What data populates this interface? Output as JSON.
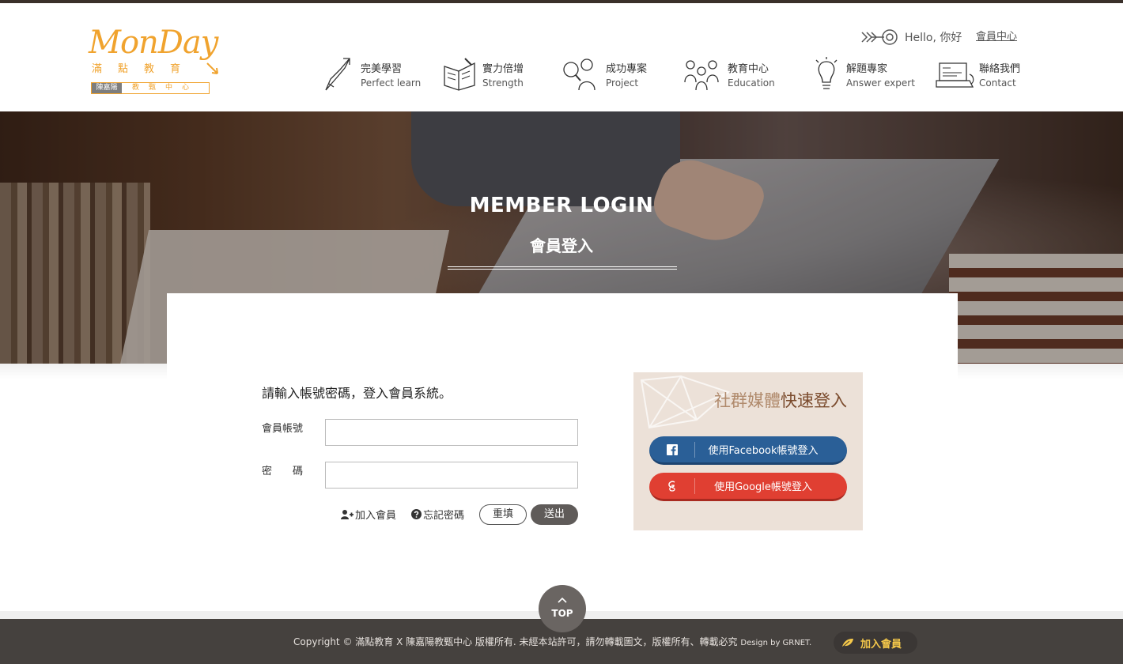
{
  "header": {
    "logo": {
      "brand": "MonDay",
      "brand_zh": "滿點教育",
      "sub_left": "陳嘉陽",
      "sub_right": "教甄中心"
    },
    "hello": "Hello, 你好",
    "member_center": "會員中心",
    "nav": [
      {
        "zh": "完美學習",
        "en": "Perfect learn",
        "icon": "rocket-arrow-icon"
      },
      {
        "zh": "實力倍增",
        "en": "Strength",
        "icon": "open-book-icon"
      },
      {
        "zh": "成功專案",
        "en": "Project",
        "icon": "magnifier-person-icon"
      },
      {
        "zh": "教育中心",
        "en": "Education",
        "icon": "people-group-icon"
      },
      {
        "zh": "解題專家",
        "en": "Answer expert",
        "icon": "lightbulb-icon"
      },
      {
        "zh": "聯絡我們",
        "en": "Contact",
        "icon": "laptop-icon"
      }
    ]
  },
  "hero": {
    "title": "MEMBER LOGIN",
    "subtitle": "會員登入"
  },
  "login": {
    "intro": "請輸入帳號密碼，登入會員系統。",
    "username_label": "會員帳號",
    "password_label": "密碼",
    "username_value": "",
    "password_value": "",
    "join_link": "加入會員",
    "forgot_link": "忘記密碼",
    "reset_button": "重填",
    "submit_button": "送出"
  },
  "social": {
    "title_light": "社群媒體",
    "title_accent": "快速登入",
    "facebook_button": "使用Facebook帳號登入",
    "google_button": "使用Google帳號登入"
  },
  "footer": {
    "copyright": "Copyright © 滿點教育 X 陳嘉陽教甄中心 版權所有. 未經本站許可，請勿轉載圖文，版權所有、轉載必究",
    "design": "Design by GRNET.",
    "join_button": "加入會員",
    "top_button": "TOP"
  },
  "colors": {
    "brand_orange": "#f0a32e",
    "footer_bg": "#45413e",
    "facebook_blue": "#2a5f97",
    "google_red": "#e03f32",
    "social_panel_bg": "#ece1d8",
    "join_yellow": "#f6c94a"
  }
}
